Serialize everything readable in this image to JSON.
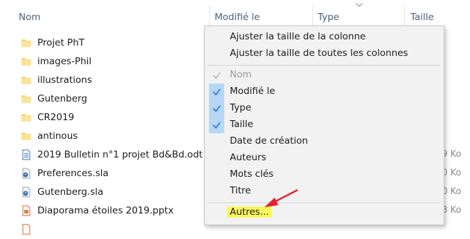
{
  "header": {
    "col_name": "Nom",
    "col_modified": "Modifié le",
    "col_type": "Type",
    "col_size": "Taille"
  },
  "files": [
    {
      "name": "Projet PhT",
      "icon": "folder-icon",
      "size": ""
    },
    {
      "name": "images-Phil",
      "icon": "folder-icon",
      "size": ""
    },
    {
      "name": "illustrations",
      "icon": "folder-icon",
      "size": ""
    },
    {
      "name": "Gutenberg",
      "icon": "folder-icon",
      "size": ""
    },
    {
      "name": "CR2019",
      "icon": "folder-icon",
      "size": ""
    },
    {
      "name": "antinous",
      "icon": "folder-icon",
      "size": ""
    },
    {
      "name": "2019 Bulletin n°1 projet Bd&Bd.odt",
      "icon": "odt-document-icon",
      "size": "39 Ko"
    },
    {
      "name": "Preferences.sla",
      "icon": "sla-file-icon",
      "size": "10 Ko"
    },
    {
      "name": "Gutenberg.sla",
      "icon": "sla-file-icon",
      "size": "10 Ko"
    },
    {
      "name": "Diaporama étoiles 2019.pptx",
      "icon": "pptx-file-icon",
      "size": "23 Ko"
    }
  ],
  "context_menu": {
    "resize_column": "Ajuster la taille de la colonne",
    "resize_all_columns": "Ajuster la taille de toutes les colonnes",
    "columns": [
      {
        "label": "Nom",
        "checked": true,
        "disabled": true
      },
      {
        "label": "Modifié le",
        "checked": true,
        "disabled": false
      },
      {
        "label": "Type",
        "checked": true,
        "disabled": false
      },
      {
        "label": "Taille",
        "checked": true,
        "disabled": false
      },
      {
        "label": "Date de création",
        "checked": false,
        "disabled": false
      },
      {
        "label": "Auteurs",
        "checked": false,
        "disabled": false
      },
      {
        "label": "Mots clés",
        "checked": false,
        "disabled": false
      },
      {
        "label": "Titre",
        "checked": false,
        "disabled": false
      }
    ],
    "more": "Autres...",
    "more_highlight_color": "#fbf85e",
    "check_color": "#2f7ad1",
    "check_bg_color": "#b7d7f4"
  },
  "annotation": {
    "arrow_color": "#e8202a"
  }
}
